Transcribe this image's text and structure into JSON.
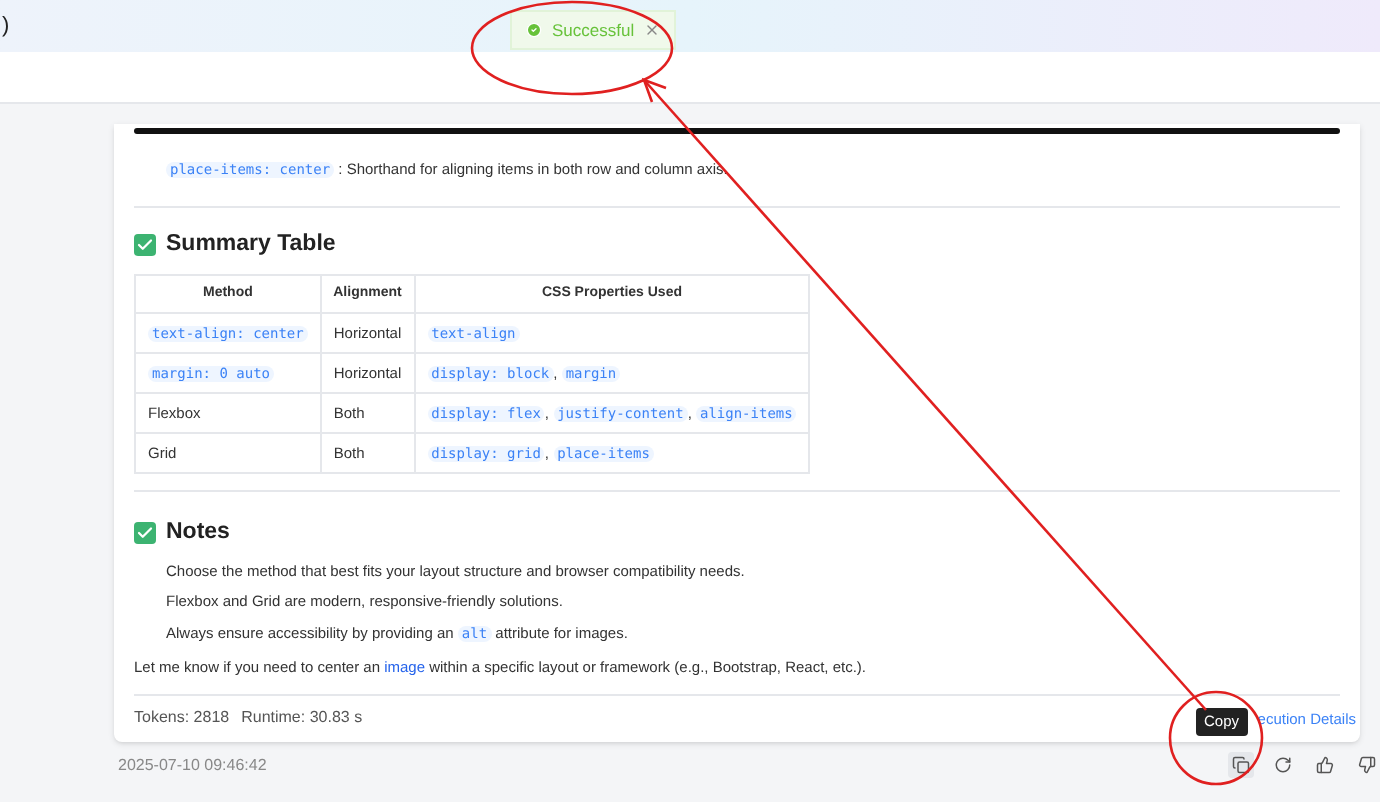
{
  "header": {
    "title_fragment": ")"
  },
  "toast": {
    "message": "Successful"
  },
  "intro": [
    {
      "kind": "code",
      "text": "place-items: center"
    },
    {
      "kind": "text",
      "text": " : Shorthand for aligning items in both row and column axis."
    }
  ],
  "summary": {
    "heading": "Summary Table",
    "columns": [
      "Method",
      "Alignment",
      "CSS Properties Used"
    ],
    "rows": [
      {
        "cells": [
          [
            {
              "kind": "code",
              "text": "text-align: center"
            }
          ],
          [
            {
              "kind": "text",
              "text": "Horizontal"
            }
          ],
          [
            {
              "kind": "code",
              "text": "text-align"
            }
          ]
        ]
      },
      {
        "cells": [
          [
            {
              "kind": "code",
              "text": "margin: 0 auto"
            }
          ],
          [
            {
              "kind": "text",
              "text": "Horizontal"
            }
          ],
          [
            {
              "kind": "code",
              "text": "display: block"
            },
            {
              "kind": "text",
              "text": ", "
            },
            {
              "kind": "code",
              "text": "margin"
            }
          ]
        ]
      },
      {
        "cells": [
          [
            {
              "kind": "text",
              "text": "Flexbox"
            }
          ],
          [
            {
              "kind": "text",
              "text": "Both"
            }
          ],
          [
            {
              "kind": "code",
              "text": "display: flex"
            },
            {
              "kind": "text",
              "text": ", "
            },
            {
              "kind": "code",
              "text": "justify-content"
            },
            {
              "kind": "text",
              "text": ", "
            },
            {
              "kind": "code",
              "text": "align-items"
            }
          ]
        ]
      },
      {
        "cells": [
          [
            {
              "kind": "text",
              "text": "Grid"
            }
          ],
          [
            {
              "kind": "text",
              "text": "Both"
            }
          ],
          [
            {
              "kind": "code",
              "text": "display: grid"
            },
            {
              "kind": "text",
              "text": ", "
            },
            {
              "kind": "code",
              "text": "place-items"
            }
          ]
        ]
      }
    ]
  },
  "notes": {
    "heading": "Notes",
    "items": [
      [
        {
          "kind": "text",
          "text": "Choose the method that best fits your layout structure and browser compatibility needs."
        }
      ],
      [
        {
          "kind": "text",
          "text": "Flexbox and Grid are modern, responsive-friendly solutions."
        }
      ],
      [
        {
          "kind": "text",
          "text": "Always ensure accessibility by providing an "
        },
        {
          "kind": "code",
          "text": "alt"
        },
        {
          "kind": "text",
          "text": " attribute for images."
        }
      ]
    ]
  },
  "closing": [
    {
      "kind": "text",
      "text": "Let me know if you need to center an "
    },
    {
      "kind": "link",
      "text": "image"
    },
    {
      "kind": "text",
      "text": " within a specific layout or framework (e.g., Bootstrap, React, etc.)."
    }
  ],
  "footer": {
    "tokens": "Tokens: 2818",
    "runtime": "Runtime: 30.83 s",
    "details_link": "ecution Details"
  },
  "timestamp": "2025-07-10 09:46:42",
  "actions": [
    {
      "kind": "copy",
      "hovered": true
    },
    {
      "kind": "refresh",
      "hovered": false
    },
    {
      "kind": "thumbs-up",
      "hovered": false
    },
    {
      "kind": "thumbs-down",
      "hovered": false
    }
  ],
  "tooltip": "Copy"
}
